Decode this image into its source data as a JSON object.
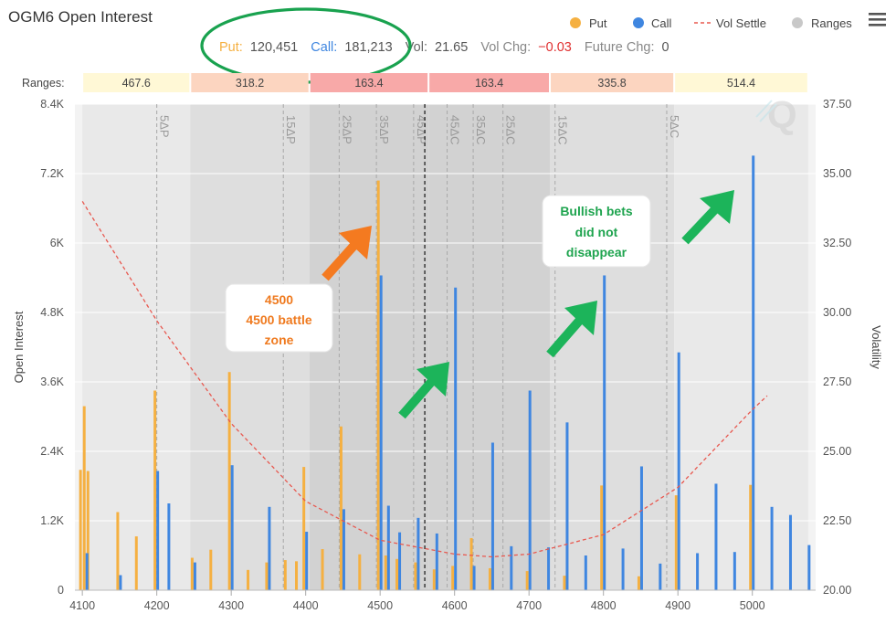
{
  "title": "OGM6 Open Interest",
  "summary": {
    "put_label": "Put:",
    "put_value": "120,451",
    "call_label": "Call:",
    "call_value": "181,213",
    "vol_label": "Vol:",
    "vol_value": "21.65",
    "vol_chg_label": "Vol Chg:",
    "vol_chg_value": "−0.03",
    "future_chg_label": "Future Chg:",
    "future_chg_value": "0"
  },
  "legend": [
    "Put",
    "Call",
    "Vol Settle",
    "Ranges"
  ],
  "menu_icon": "hamburger-icon",
  "watermark_icon": "q-logo-icon",
  "ranges_label": "Ranges:",
  "ranges": [
    {
      "label": "467.6",
      "from": 4100,
      "to": 4245,
      "color": "#fff8d6"
    },
    {
      "label": "318.2",
      "from": 4245,
      "to": 4405,
      "color": "#fcd5c0"
    },
    {
      "label": "163.4",
      "from": 4405,
      "to": 4565,
      "color": "#f8a9a8"
    },
    {
      "label": "163.4",
      "from": 4565,
      "to": 4728,
      "color": "#f8a9a8"
    },
    {
      "label": "335.8",
      "from": 4728,
      "to": 4895,
      "color": "#fcd5c0"
    },
    {
      "label": "514.4",
      "from": 4895,
      "to": 5075,
      "color": "#fff8d6"
    }
  ],
  "annotations": [
    {
      "lines": [
        "4500",
        "4500 battle",
        "zone"
      ],
      "color": "orange"
    },
    {
      "lines": [
        "Bullish bets",
        "did not",
        "disappear"
      ],
      "color": "green"
    }
  ],
  "colors": {
    "put": "#f5b041",
    "call": "#3f86e0",
    "vol": "#e8584f",
    "arrow_orange": "#f47a20",
    "arrow_green": "#1cb45a",
    "circle": "#19a24f"
  },
  "chart_data": {
    "type": "bar",
    "xlabel": "",
    "ylabel": "Open Interest",
    "y2label": "Volatility",
    "xlim": [
      4090,
      5085
    ],
    "ylim": [
      0,
      8400
    ],
    "y2lim": [
      20.0,
      37.5
    ],
    "x_ticks": [
      4100,
      4200,
      4300,
      4400,
      4500,
      4600,
      4700,
      4800,
      4900,
      5000
    ],
    "y_ticks": [
      "0",
      "1.2K",
      "2.4K",
      "3.6K",
      "4.8K",
      "6K",
      "7.2K",
      "8.4K"
    ],
    "y_tick_values": [
      0,
      1200,
      2400,
      3600,
      4800,
      6000,
      7200,
      8400
    ],
    "y2_ticks": [
      "20.00",
      "22.50",
      "25.00",
      "27.50",
      "30.00",
      "32.50",
      "35.00",
      "37.50"
    ],
    "y2_tick_values": [
      20.0,
      22.5,
      25.0,
      27.5,
      30.0,
      32.5,
      35.0,
      37.5
    ],
    "delta_lines": [
      {
        "label": "5ΔP",
        "x": 4200
      },
      {
        "label": "15ΔP",
        "x": 4370
      },
      {
        "label": "25ΔP",
        "x": 4445
      },
      {
        "label": "35ΔP",
        "x": 4495
      },
      {
        "label": "45ΔP",
        "x": 4545
      },
      {
        "label": "45ΔC",
        "x": 4590
      },
      {
        "label": "35ΔC",
        "x": 4625
      },
      {
        "label": "25ΔC",
        "x": 4665
      },
      {
        "label": "15ΔC",
        "x": 4735
      },
      {
        "label": "5ΔC",
        "x": 4885
      }
    ],
    "atm_line": 4560,
    "series": [
      {
        "name": "Put",
        "x": [
          4100,
          4105,
          4110,
          4150,
          4175,
          4200,
          4250,
          4275,
          4300,
          4325,
          4350,
          4375,
          4390,
          4400,
          4425,
          4450,
          4475,
          4500,
          4510,
          4525,
          4550,
          4575,
          4600,
          4625,
          4650,
          4700,
          4750,
          4800,
          4850,
          4900,
          5000
        ],
        "y": [
          2080,
          3180,
          2060,
          1350,
          930,
          3450,
          560,
          700,
          3770,
          350,
          480,
          520,
          500,
          2130,
          710,
          2830,
          620,
          7080,
          600,
          540,
          480,
          360,
          420,
          900,
          380,
          330,
          250,
          1810,
          240,
          1640,
          1820
        ]
      },
      {
        "name": "Call",
        "x": [
          4105,
          4150,
          4200,
          4215,
          4250,
          4300,
          4350,
          4400,
          4450,
          4500,
          4510,
          4525,
          4550,
          4575,
          4600,
          4625,
          4650,
          4675,
          4700,
          4725,
          4750,
          4775,
          4800,
          4825,
          4850,
          4875,
          4900,
          4925,
          4950,
          4975,
          5000,
          5025,
          5050,
          5075
        ],
        "y": [
          640,
          260,
          2060,
          1500,
          480,
          2160,
          1440,
          1010,
          1400,
          5440,
          1460,
          1000,
          1250,
          980,
          5230,
          420,
          2550,
          760,
          3450,
          740,
          2900,
          600,
          5440,
          720,
          2140,
          460,
          4110,
          640,
          1840,
          660,
          7510,
          1440,
          1300,
          780
        ]
      }
    ],
    "vol_settle": {
      "x": [
        4100,
        4200,
        4300,
        4400,
        4500,
        4600,
        4650,
        4700,
        4800,
        4900,
        5000,
        5020
      ],
      "y": [
        34.0,
        29.7,
        26.0,
        23.2,
        21.8,
        21.3,
        21.2,
        21.3,
        22.0,
        23.7,
        26.5,
        27.0
      ]
    }
  }
}
